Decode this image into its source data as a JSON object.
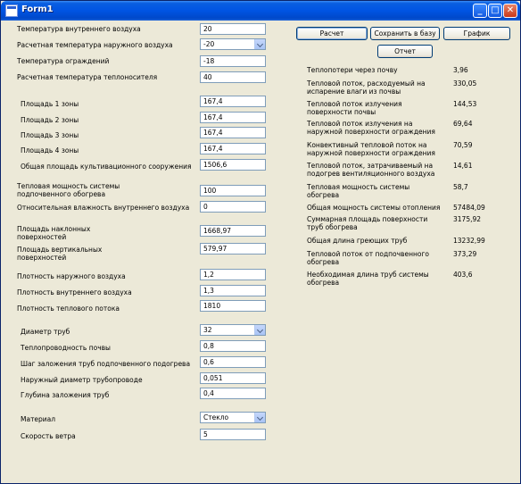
{
  "window": {
    "title": "Form1",
    "minimize": "_",
    "maximize": "□",
    "close": "✕"
  },
  "fields": {
    "inner_temp": {
      "label": "Температура внутреннего воздуха",
      "value": "20"
    },
    "outer_temp": {
      "label": "Расчетная температура наружного воздуха",
      "value": "-20"
    },
    "fence_temp": {
      "label": "Температура ограждений",
      "value": "-18"
    },
    "carrier_temp": {
      "label": "Расчетная температура теплоносителя",
      "value": "40"
    },
    "zone1": {
      "label": "Площадь 1 зоны",
      "value": "167,4"
    },
    "zone2": {
      "label": "Площадь 2 зоны",
      "value": "167,4"
    },
    "zone3": {
      "label": "Площадь 3 зоны",
      "value": "167,4"
    },
    "zone4": {
      "label": "Площадь 4 зоны",
      "value": "167,4"
    },
    "total_area": {
      "label": "Общая площадь культивационного сооружения",
      "value": "1506,6"
    },
    "heat_power": {
      "label": "Тепловая мощность системы подпочвенного обогрева",
      "value": "100"
    },
    "humidity": {
      "label": "Относительная влажность внутреннего воздуха",
      "value": "0"
    },
    "inclined_area": {
      "label": "Площадь наклонных поверхностей",
      "value": "1668,97"
    },
    "vertical_area": {
      "label": "Площадь вертикальных поверхностей",
      "value": "579,97"
    },
    "outer_density": {
      "label": "Плотность наружного воздуха",
      "value": "1,2"
    },
    "inner_density": {
      "label": "Плотность внутреннего воздуха",
      "value": "1,3"
    },
    "heat_flux_density": {
      "label": "Плотность теплового потока",
      "value": "1810"
    },
    "pipe_diameter": {
      "label": "Диаметр труб",
      "value": "32"
    },
    "soil_conductivity": {
      "label": "Теплопроводность почвы",
      "value": "0,8"
    },
    "pipe_step": {
      "label": "Шаг заложения труб подпочвенного подогрева",
      "value": "0,6"
    },
    "outer_pipe_diameter": {
      "label": "Наружный диаметр трубопроводе",
      "value": "0,051"
    },
    "pipe_depth": {
      "label": "Глубина заложения труб",
      "value": "0,4"
    },
    "material": {
      "label": "Материал",
      "value": "Стекло"
    },
    "wind_speed": {
      "label": "Скорость ветра",
      "value": "5"
    }
  },
  "buttons": {
    "calculate": "Расчет",
    "save": "Сохранить в базу",
    "chart": "График",
    "report": "Отчет"
  },
  "results": [
    {
      "label": "Теплопотери через почву",
      "value": "3,96"
    },
    {
      "label": "Тепловой поток, расходуемый на испарение влаги из почвы",
      "value": "330,05"
    },
    {
      "label": "Тепловой поток излучения поверхности почвы",
      "value": "144,53"
    },
    {
      "label": "Тепловой поток излучения на наружной поверхности ограждения",
      "value": "69,64"
    },
    {
      "label": "Конвективный тепловой поток на наружной поверхности ограждения",
      "value": "70,59"
    },
    {
      "label": "Тепловой поток, затрачиваемый на подогрев вентиляционного воздуха",
      "value": "14,61"
    },
    {
      "label": "Тепловая мощность системы обогрева",
      "value": "58,7"
    },
    {
      "label": "Общая мощность системы отопления",
      "value": "57484,09"
    },
    {
      "label": "Суммарная площадь поверхности труб обогрева",
      "value": "3175,92"
    },
    {
      "label": "Общая длина греющих труб",
      "value": "13232,99"
    },
    {
      "label": "Тепловой поток от подпочвенного обогрева",
      "value": "373,29"
    },
    {
      "label": "Необходимая длина труб системы обогрева",
      "value": "403,6"
    }
  ]
}
